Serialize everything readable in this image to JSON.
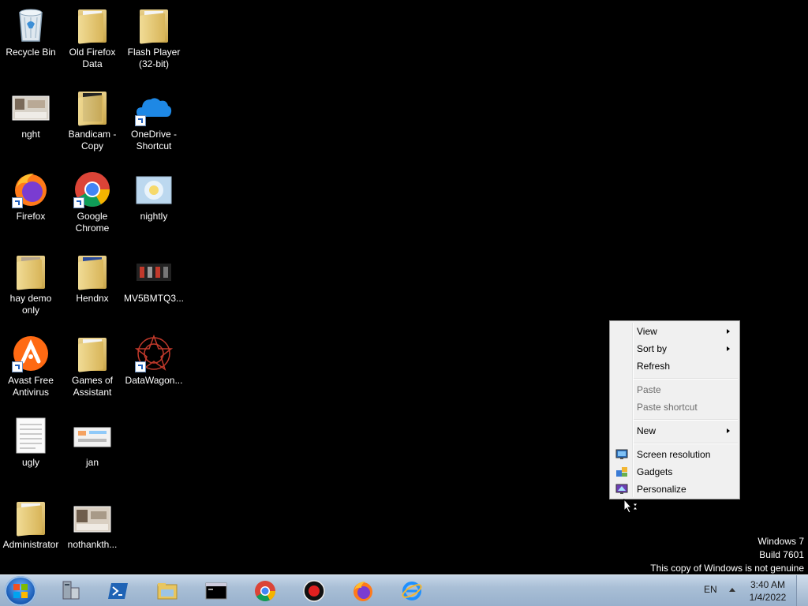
{
  "desktop": {
    "icons": [
      {
        "name": "recycle-bin",
        "label": "Recycle Bin"
      },
      {
        "name": "old-firefox-data",
        "label": "Old Firefox Data"
      },
      {
        "name": "flash-player",
        "label": "Flash Player (32-bit)"
      },
      {
        "name": "nght",
        "label": "nght"
      },
      {
        "name": "bandicam-copy",
        "label": "Bandicam - Copy"
      },
      {
        "name": "onedrive-shortcut",
        "label": "OneDrive - Shortcut"
      },
      {
        "name": "firefox",
        "label": "Firefox"
      },
      {
        "name": "google-chrome",
        "label": "Google Chrome"
      },
      {
        "name": "nightly",
        "label": "nightly"
      },
      {
        "name": "hay-demo-only",
        "label": "hay demo only"
      },
      {
        "name": "hendnx",
        "label": "Hendnx"
      },
      {
        "name": "mv5bmtq3",
        "label": "MV5BMTQ3..."
      },
      {
        "name": "avast-free-antivirus",
        "label": "Avast Free Antivirus"
      },
      {
        "name": "games-of-assistant",
        "label": "Games of Assistant"
      },
      {
        "name": "datawagon",
        "label": "DataWagon..."
      },
      {
        "name": "ugly",
        "label": "ugly"
      },
      {
        "name": "jan",
        "label": "jan"
      },
      {
        "name": "administrator",
        "label": "Administrator"
      },
      {
        "name": "nothankth",
        "label": "nothankth..."
      }
    ]
  },
  "context_menu": {
    "view": "View",
    "sort_by": "Sort by",
    "refresh": "Refresh",
    "paste": "Paste",
    "paste_shortcut": "Paste shortcut",
    "new": "New",
    "screen_resolution": "Screen resolution",
    "gadgets": "Gadgets",
    "personalize": "Personalize"
  },
  "watermark": {
    "line1": "Windows 7",
    "line2": "Build 7601",
    "line3": "This copy of Windows is not genuine"
  },
  "taskbar": {
    "apps": [
      "server-manager-icon",
      "powershell-icon",
      "file-explorer-icon",
      "command-prompt-icon",
      "chrome-icon",
      "bandicam-record-icon",
      "firefox-icon",
      "internet-explorer-icon"
    ],
    "language": "EN",
    "time": "3:40 AM",
    "date": "1/4/2022"
  },
  "colors": {
    "desktop_background": "#000000",
    "menu_background": "#f0f0f0",
    "taskbar": "#a9bfd6"
  }
}
